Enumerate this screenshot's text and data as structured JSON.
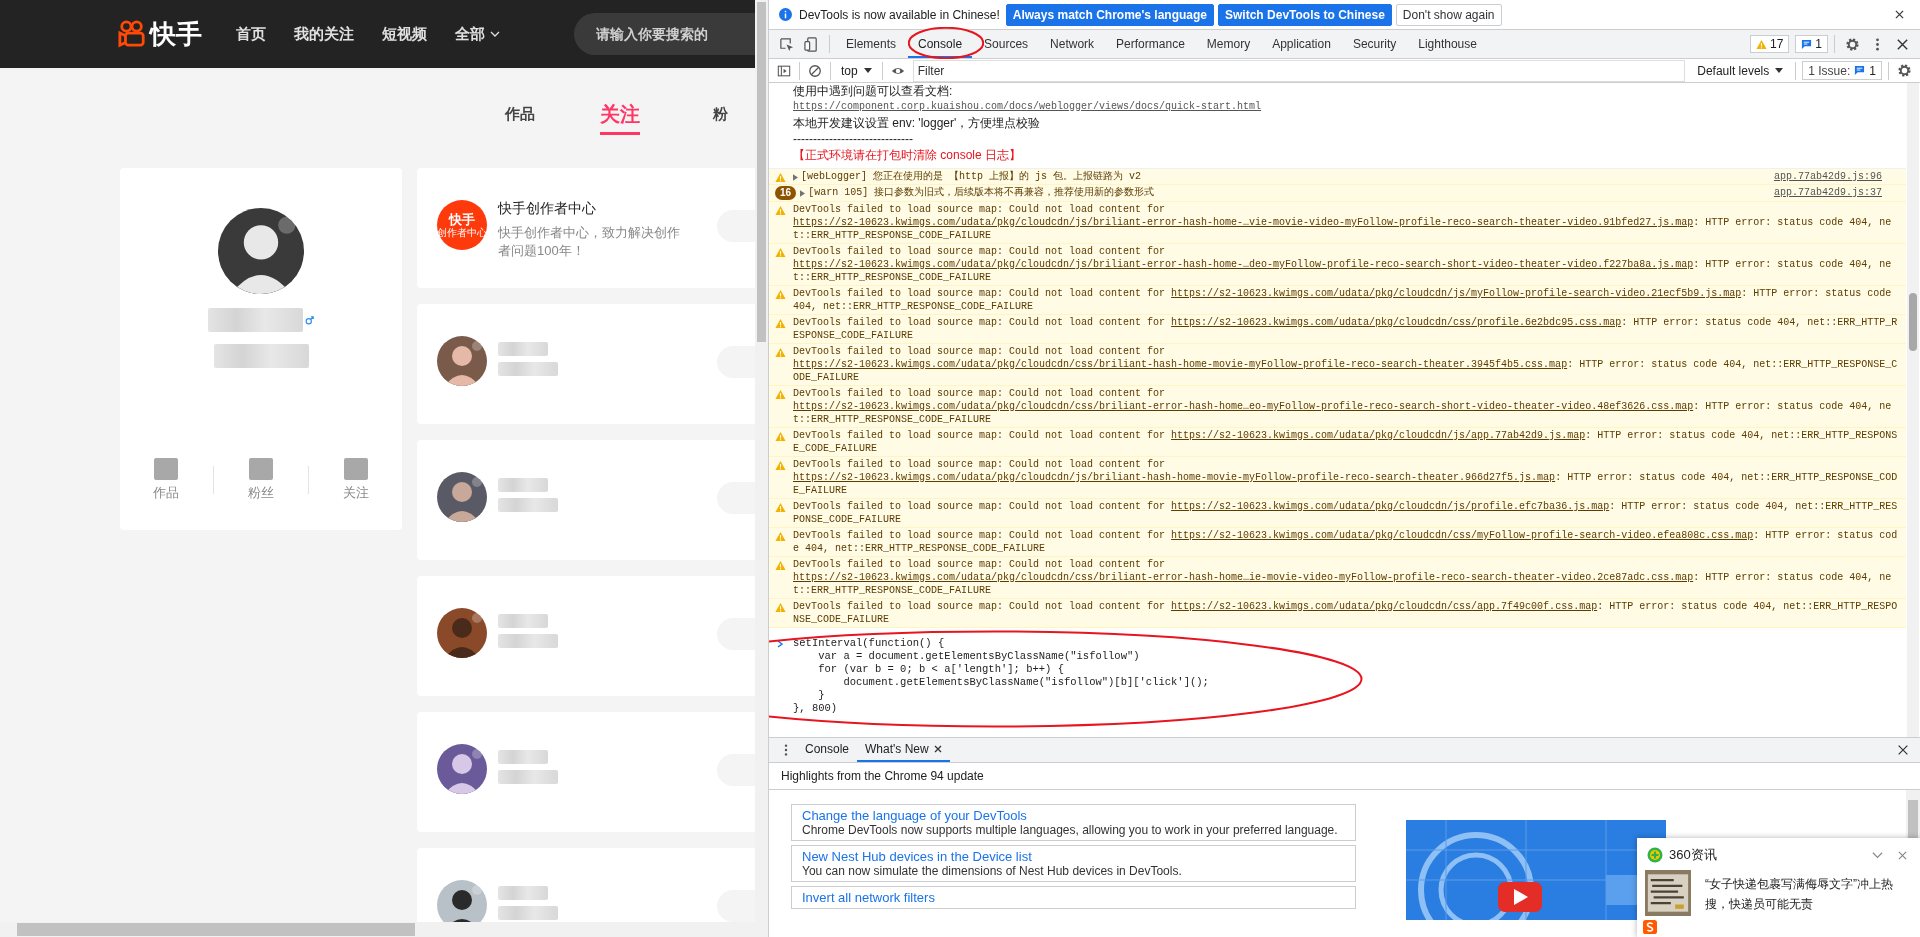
{
  "page": {
    "header": {
      "logo": "快手",
      "nav": [
        {
          "label": "首页",
          "dropdown": false
        },
        {
          "label": "我的关注",
          "dropdown": false
        },
        {
          "label": "短视频",
          "dropdown": false
        },
        {
          "label": "全部",
          "dropdown": true
        }
      ],
      "search": {
        "placeholder": "请输入你要搜索的"
      }
    },
    "tabs": [
      {
        "label": "作品",
        "selected": false
      },
      {
        "label": "关注",
        "selected": true
      },
      {
        "label": "粉",
        "selected": false
      }
    ],
    "profile": {
      "avatar": {
        "kind": "picture"
      },
      "stats": [
        {
          "label": "作品"
        },
        {
          "label": "粉丝"
        },
        {
          "label": "关注"
        }
      ]
    },
    "following": [
      {
        "badge_lines": [
          "快手",
          "创作者中心"
        ],
        "name": "快手创作者中心",
        "description": "快手创作者中心，致力解决创作者问题100年！"
      },
      {
        "avatar": {
          "kind": "picture"
        }
      },
      {
        "avatar": {
          "kind": "picture"
        }
      },
      {
        "avatar": {
          "kind": "picture"
        }
      },
      {
        "avatar": {
          "kind": "picture"
        }
      },
      {
        "avatar": {
          "kind": "picture"
        }
      }
    ]
  },
  "devtools": {
    "infobar": {
      "message": "DevTools is now available in Chinese!",
      "buttons": [
        {
          "label": "Always match Chrome's language",
          "kind": "primary"
        },
        {
          "label": "Switch DevTools to Chinese",
          "kind": "primary"
        },
        {
          "label": "Don't show again",
          "kind": "secondary"
        }
      ]
    },
    "tabs": [
      {
        "label": "Elements",
        "selected": false
      },
      {
        "label": "Console",
        "selected": true
      },
      {
        "label": "Sources",
        "selected": false
      },
      {
        "label": "Network",
        "selected": false
      },
      {
        "label": "Performance",
        "selected": false
      },
      {
        "label": "Memory",
        "selected": false
      },
      {
        "label": "Application",
        "selected": false
      },
      {
        "label": "Security",
        "selected": false
      },
      {
        "label": "Lighthouse",
        "selected": false
      }
    ],
    "warnings_count": "17",
    "messages_count": "1",
    "console_toolbar": {
      "context": "top",
      "filter_placeholder": "Filter",
      "levels": "Default levels",
      "issues_label": "1 Issue:",
      "issues_count": "1"
    },
    "console": [
      {
        "kind": "log",
        "text": "使用中遇到问题可以查看文档:"
      },
      {
        "kind": "link",
        "text": "https://component.corp.kuaishou.com/docs/weblogger/views/docs/quick-start.html"
      },
      {
        "kind": "log",
        "text": "本地开发建议设置 env: 'logger'，方便埋点校验"
      },
      {
        "kind": "log",
        "text": "------------------------------"
      },
      {
        "kind": "alert",
        "text": "【正式环境请在打包时清除 console 日志】"
      },
      {
        "kind": "warning",
        "text": "[webLogger] 您正在使用的是 【http 上报】的 js 包。上报链路为 v2",
        "source": "app.77ab42d9.js:96"
      },
      {
        "kind": "warning",
        "count": "16",
        "text": "[warn 105] 接口参数为旧式，后续版本将不再兼容，推荐使用新的参数形式",
        "source": "app.77ab42d9.js:37"
      },
      {
        "kind": "sourcemap",
        "prefix": "DevTools failed to load source map: Could not load content for ",
        "url": "https://s2-10623.kwimgs.com/udata/pkg/cloudcdn/js/briliant-error-hash-home-…vie-movie-video-myFollow-profile-reco-search-theater-video.91bfed27.js.map",
        "suffix": ": HTTP error: status code 404, net::ERR_HTTP_RESPONSE_CODE_FAILURE"
      },
      {
        "kind": "sourcemap",
        "prefix": "DevTools failed to load source map: Could not load content for ",
        "url": "https://s2-10623.kwimgs.com/udata/pkg/cloudcdn/js/briliant-error-hash-home-…deo-myFollow-profile-reco-search-short-video-theater-video.f227ba8a.js.map",
        "suffix": ": HTTP error: status code 404, net::ERR_HTTP_RESPONSE_CODE_FAILURE"
      },
      {
        "kind": "sourcemap",
        "prefix": "DevTools failed to load source map: Could not load content for ",
        "url": "https://s2-10623.kwimgs.com/udata/pkg/cloudcdn/js/myFollow-profile-search-video.21ecf5b9.js.map",
        "suffix": ": HTTP error: status code 404, net::ERR_HTTP_RESPONSE_CODE_FAILURE"
      },
      {
        "kind": "sourcemap",
        "prefix": "DevTools failed to load source map: Could not load content for ",
        "url": "https://s2-10623.kwimgs.com/udata/pkg/cloudcdn/css/profile.6e2bdc95.css.map",
        "suffix": ": HTTP error: status code 404, net::ERR_HTTP_RESPONSE_CODE_FAILURE"
      },
      {
        "kind": "sourcemap",
        "prefix": "DevTools failed to load source map: Could not load content for ",
        "url": "https://s2-10623.kwimgs.com/udata/pkg/cloudcdn/css/briliant-hash-home-movie-myFollow-profile-reco-search-theater.3945f4b5.css.map",
        "suffix": ": HTTP error: status code 404, net::ERR_HTTP_RESPONSE_CODE_FAILURE"
      },
      {
        "kind": "sourcemap",
        "prefix": "DevTools failed to load source map: Could not load content for ",
        "url": "https://s2-10623.kwimgs.com/udata/pkg/cloudcdn/css/briliant-error-hash-home…eo-myFollow-profile-reco-search-short-video-theater-video.48ef3626.css.map",
        "suffix": ": HTTP error: status code 404, net::ERR_HTTP_RESPONSE_CODE_FAILURE"
      },
      {
        "kind": "sourcemap",
        "prefix": "DevTools failed to load source map: Could not load content for ",
        "url": "https://s2-10623.kwimgs.com/udata/pkg/cloudcdn/js/app.77ab42d9.js.map",
        "suffix": ": HTTP error: status code 404, net::ERR_HTTP_RESPONSE_CODE_FAILURE"
      },
      {
        "kind": "sourcemap",
        "prefix": "DevTools failed to load source map: Could not load content for ",
        "url": "https://s2-10623.kwimgs.com/udata/pkg/cloudcdn/js/briliant-hash-home-movie-myFollow-profile-reco-search-theater.966d27f5.js.map",
        "suffix": ": HTTP error: status code 404, net::ERR_HTTP_RESPONSE_CODE_FAILURE"
      },
      {
        "kind": "sourcemap",
        "prefix": "DevTools failed to load source map: Could not load content for ",
        "url": "https://s2-10623.kwimgs.com/udata/pkg/cloudcdn/js/profile.efc7ba36.js.map",
        "suffix": ": HTTP error: status code 404, net::ERR_HTTP_RESPONSE_CODE_FAILURE"
      },
      {
        "kind": "sourcemap",
        "prefix": "DevTools failed to load source map: Could not load content for ",
        "url": "https://s2-10623.kwimgs.com/udata/pkg/cloudcdn/css/myFollow-profile-search-video.efea808c.css.map",
        "suffix": ": HTTP error: status code 404, net::ERR_HTTP_RESPONSE_CODE_FAILURE"
      },
      {
        "kind": "sourcemap",
        "prefix": "DevTools failed to load source map: Could not load content for ",
        "url": "https://s2-10623.kwimgs.com/udata/pkg/cloudcdn/css/briliant-error-hash-home…ie-movie-video-myFollow-profile-reco-search-theater-video.2ce87adc.css.map",
        "suffix": ": HTTP error: status code 404, net::ERR_HTTP_RESPONSE_CODE_FAILURE"
      },
      {
        "kind": "sourcemap",
        "prefix": "DevTools failed to load source map: Could not load content for ",
        "url": "https://s2-10623.kwimgs.com/udata/pkg/cloudcdn/css/app.7f49c00f.css.map",
        "suffix": ": HTTP error: status code 404, net::ERR_HTTP_RESPONSE_CODE_FAILURE"
      }
    ],
    "input": {
      "lines": [
        "setInterval(function() {",
        "    var a = document.getElementsByClassName(\"isfollow\")",
        "    for (var b = 0; b < a['length']; b++) {",
        "        document.getElementsByClassName(\"isfollow\")[b]['click']();",
        "    }",
        "}, 800)"
      ]
    },
    "drawer": {
      "tabs": [
        {
          "label": "Console",
          "selected": false,
          "closable": false
        },
        {
          "label": "What's New",
          "selected": true,
          "closable": true
        }
      ],
      "heading": "Highlights from the Chrome 94 update",
      "cards": [
        {
          "title": "Change the language of your DevTools",
          "description": "Chrome DevTools now supports multiple languages, allowing you to work in your preferred language."
        },
        {
          "title": "New Nest Hub devices in the Device list",
          "description": "You can now simulate the dimensions of Nest Hub devices in DevTools."
        },
        {
          "title": "Invert all network filters"
        }
      ],
      "video": {
        "kind": "picture"
      }
    }
  },
  "notification": {
    "source": "360资讯",
    "headline": "“女子快递包裹写满侮辱文字”冲上热搜，快递员可能无责",
    "thumbnail": {
      "kind": "picture"
    }
  },
  "annotations": [
    {
      "kind": "ellipse"
    },
    {
      "kind": "ellipse"
    }
  ]
}
